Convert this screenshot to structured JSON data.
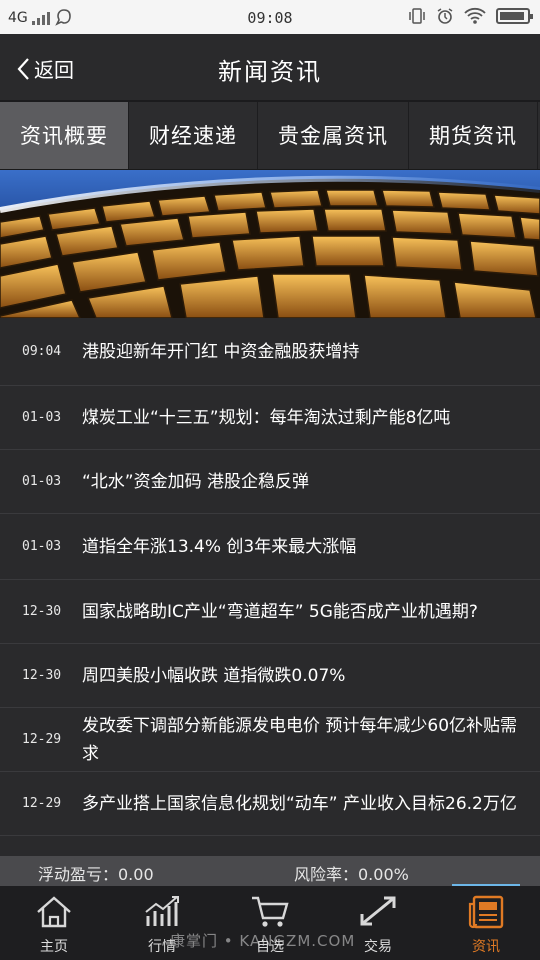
{
  "status": {
    "network": "4G",
    "time": "09:08"
  },
  "header": {
    "back_label": "返回",
    "title": "新闻资讯"
  },
  "tabs": [
    {
      "label": "资讯概要",
      "active": true
    },
    {
      "label": "财经速递",
      "active": false
    },
    {
      "label": "贵金属资讯",
      "active": false
    },
    {
      "label": "期货资讯",
      "active": false
    }
  ],
  "news": [
    {
      "date": "09:04",
      "title": "港股迎新年开门红 中资金融股获增持"
    },
    {
      "date": "01-03",
      "title": "煤炭工业“十三五”规划：每年淘汰过剩产能8亿吨"
    },
    {
      "date": "01-03",
      "title": "“北水”资金加码 港股企稳反弹"
    },
    {
      "date": "01-03",
      "title": "道指全年涨13.4% 创3年来最大涨幅"
    },
    {
      "date": "12-30",
      "title": "国家战略助IC产业“弯道超车” 5G能否成产业机遇期?"
    },
    {
      "date": "12-30",
      "title": "周四美股小幅收跌 道指微跌0.07%"
    },
    {
      "date": "12-29",
      "title": "发改委下调部分新能源发电电价 预计每年减少60亿补贴需求"
    },
    {
      "date": "12-29",
      "title": "多产业搭上国家信息化规划“动车” 产业收入目标26.2万亿"
    }
  ],
  "info": {
    "floating_pl": "浮动盈亏：0.00",
    "risk_rate": "风险率：0.00%"
  },
  "nav": [
    {
      "label": "主页",
      "icon": "home-icon"
    },
    {
      "label": "行情",
      "icon": "chart-icon"
    },
    {
      "label": "自选",
      "icon": "cart-icon"
    },
    {
      "label": "交易",
      "icon": "exchange-icon"
    },
    {
      "label": "资讯",
      "icon": "news-icon",
      "active": true
    }
  ],
  "watermark": "康掌门 • KANGZM.COM",
  "colors": {
    "accent": "#e07a24",
    "background": "#2a2a2c",
    "active_tab": "#5c5c5f",
    "nav_indicator": "#6db7e8"
  }
}
